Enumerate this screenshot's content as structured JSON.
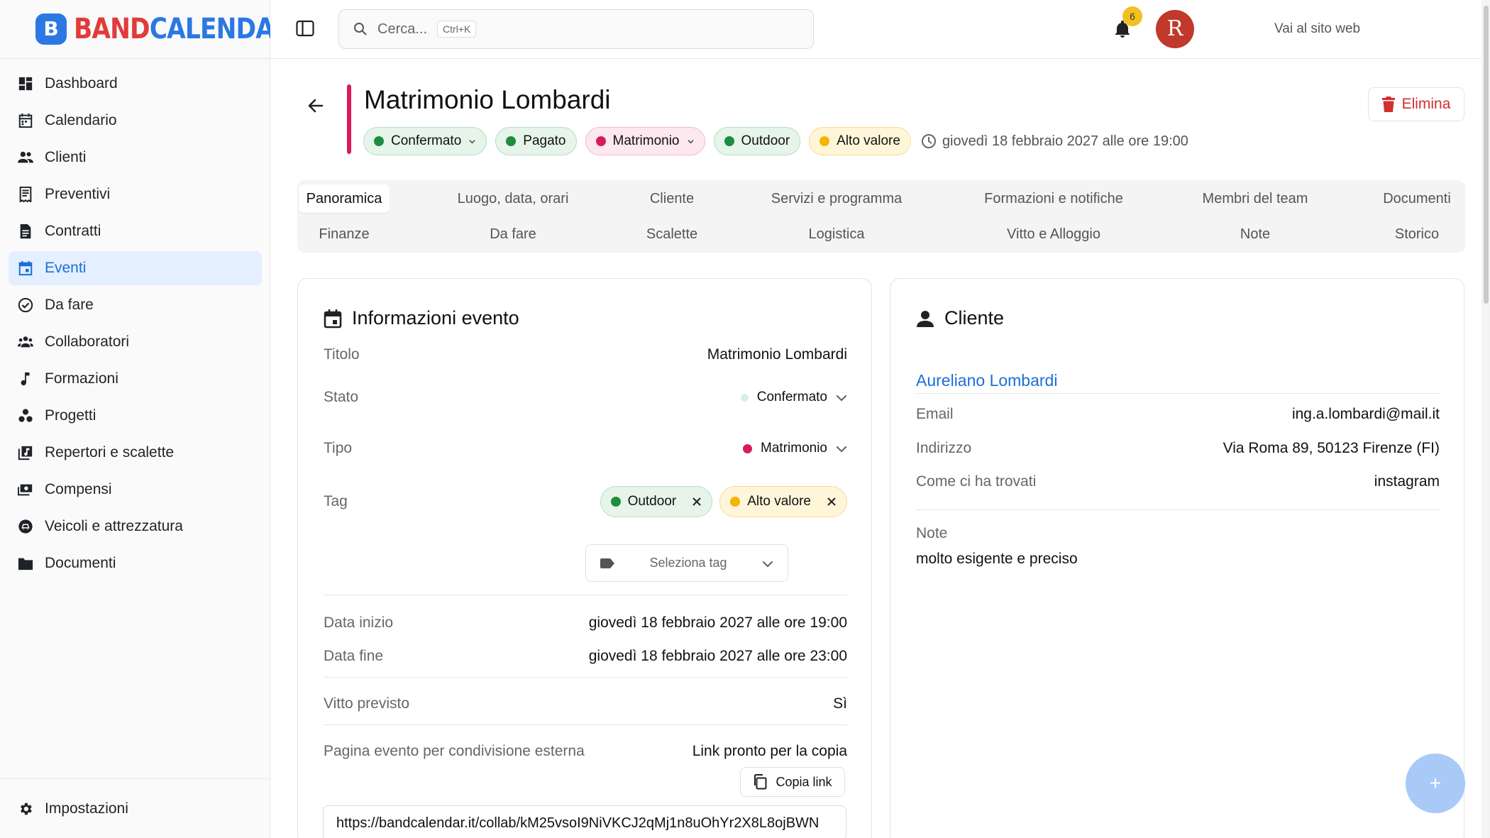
{
  "brand": {
    "part1": "BAND",
    "part2": "CALENDAR"
  },
  "nav": [
    {
      "label": "Dashboard",
      "icon": "dashboard-icon"
    },
    {
      "label": "Calendario",
      "icon": "calendar-icon"
    },
    {
      "label": "Clienti",
      "icon": "people-icon"
    },
    {
      "label": "Preventivi",
      "icon": "receipt-icon"
    },
    {
      "label": "Contratti",
      "icon": "document-icon"
    },
    {
      "label": "Eventi",
      "icon": "event-icon",
      "active": true
    },
    {
      "label": "Da fare",
      "icon": "check-circle-icon"
    },
    {
      "label": "Collaboratori",
      "icon": "group-icon"
    },
    {
      "label": "Formazioni",
      "icon": "music-note-icon"
    },
    {
      "label": "Progetti",
      "icon": "workspaces-icon"
    },
    {
      "label": "Repertori e scalette",
      "icon": "library-music-icon"
    },
    {
      "label": "Compensi",
      "icon": "payments-icon"
    },
    {
      "label": "Veicoli e attrezzatura",
      "icon": "vehicle-icon"
    },
    {
      "label": "Documenti",
      "icon": "folder-icon"
    }
  ],
  "settings": {
    "label": "Impostazioni"
  },
  "topbar": {
    "search_placeholder": "Cerca...",
    "search_shortcut": "Ctrl+K",
    "site_link": "Vai al sito web",
    "notification_count": "6",
    "avatar_initial": "R"
  },
  "event": {
    "title": "Matrimonio Lombardi",
    "chips": [
      {
        "label": "Confermato",
        "dot": "#1e8e3e",
        "bg": "#e6f4ea",
        "border": "#b7dfc2",
        "caret": true
      },
      {
        "label": "Pagato",
        "dot": "#1e8e3e",
        "bg": "#e6f4ea",
        "border": "#b7dfc2",
        "caret": false
      },
      {
        "label": "Matrimonio",
        "dot": "#d81b60",
        "bg": "#fde8ef",
        "border": "#f5b8cd",
        "caret": true
      },
      {
        "label": "Outdoor",
        "dot": "#1e8e3e",
        "bg": "#e6f4ea",
        "border": "#b7dfc2",
        "caret": false
      },
      {
        "label": "Alto valore",
        "dot": "#f4b400",
        "bg": "#fff6d9",
        "border": "#f7dd8c",
        "caret": false
      }
    ],
    "datetime": "giovedì 18 febbraio 2027 alle ore 19:00",
    "delete_label": "Elimina"
  },
  "tabs": {
    "row1": [
      "Panoramica",
      "Luogo, data, orari",
      "Cliente",
      "Servizi e programma",
      "Formazioni e notifiche",
      "Membri del team",
      "Documenti"
    ],
    "row2": [
      "Finanze",
      "Da fare",
      "Scalette",
      "Logistica",
      "Vitto e Alloggio",
      "Note",
      "Storico"
    ]
  },
  "info": {
    "heading": "Informazioni evento",
    "titolo_label": "Titolo",
    "titolo_value": "Matrimonio Lombardi",
    "stato_label": "Stato",
    "stato_value": "Confermato",
    "tipo_label": "Tipo",
    "tipo_value": "Matrimonio",
    "tag_label": "Tag",
    "tags": [
      {
        "label": "Outdoor",
        "dot": "#1e8e3e",
        "bg": "#e6f4ea",
        "border": "#b7dfc2"
      },
      {
        "label": "Alto valore",
        "dot": "#f4b400",
        "bg": "#fff6d9",
        "border": "#f7dd8c"
      }
    ],
    "select_tag_placeholder": "Seleziona tag",
    "data_inizio_label": "Data inizio",
    "data_inizio_value": "giovedì 18 febbraio 2027 alle ore 19:00",
    "data_fine_label": "Data fine",
    "data_fine_value": "giovedì 18 febbraio 2027 alle ore 23:00",
    "vitto_label": "Vitto previsto",
    "vitto_value": "Sì",
    "share_label": "Pagina evento per condivisione esterna",
    "share_status": "Link pronto per la copia",
    "copy_label": "Copia link",
    "share_url": "https://bandcalendar.it/collab/kM25vsoI9NiVKCJ2qMj1n8uOhYr2X8L8ojBWN"
  },
  "client": {
    "heading": "Cliente",
    "name": "Aureliano Lombardi",
    "email_label": "Email",
    "email_value": "ing.a.lombardi@mail.it",
    "address_label": "Indirizzo",
    "address_value": "Via Roma 89, 50123 Firenze (FI)",
    "source_label": "Come ci ha trovati",
    "source_value": "instagram",
    "notes_label": "Note",
    "notes_value": "molto esigente e preciso"
  },
  "fab_label": "+"
}
